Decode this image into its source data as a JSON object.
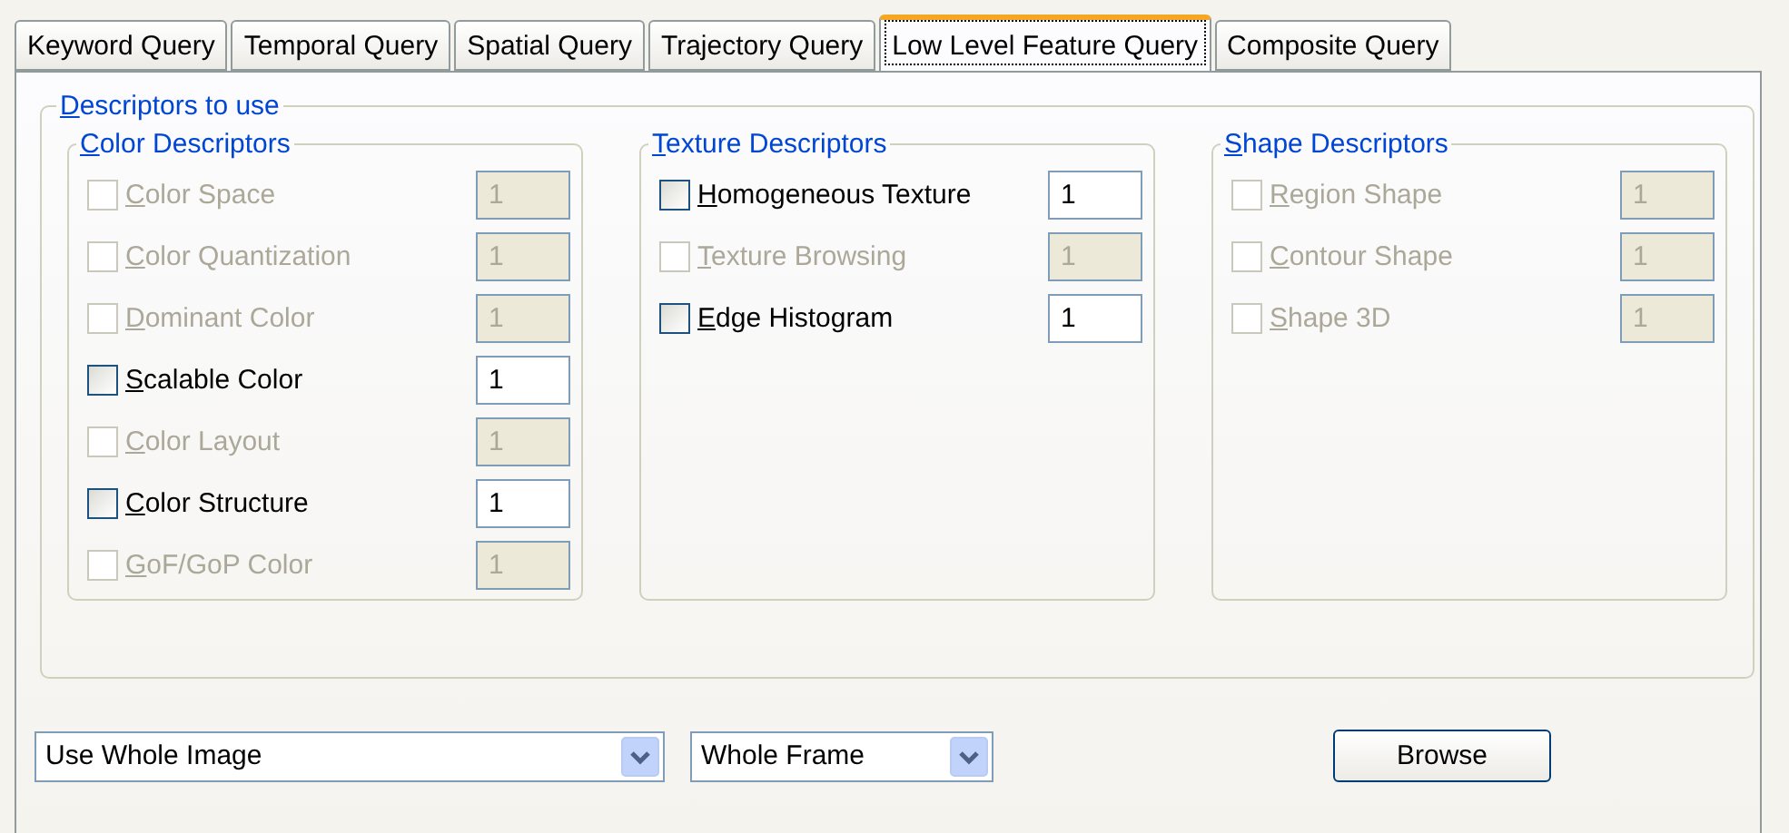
{
  "tabs": [
    {
      "label": "Keyword Query",
      "selected": false
    },
    {
      "label": "Temporal Query",
      "selected": false
    },
    {
      "label": "Spatial Query",
      "selected": false
    },
    {
      "label": "Trajectory Query",
      "selected": false
    },
    {
      "label": "Low Level Feature Query",
      "selected": true
    },
    {
      "label": "Composite Query",
      "selected": false
    }
  ],
  "descriptors": {
    "title": "Descriptors to use",
    "groups": [
      {
        "title": "Color Descriptors",
        "items": [
          {
            "label": "Color Space",
            "checked": false,
            "disabled": true,
            "value": "1"
          },
          {
            "label": "Color Quantization",
            "checked": false,
            "disabled": true,
            "value": "1"
          },
          {
            "label": "Dominant Color",
            "checked": false,
            "disabled": true,
            "value": "1"
          },
          {
            "label": "Scalable Color",
            "checked": false,
            "disabled": false,
            "value": "1"
          },
          {
            "label": "Color Layout",
            "checked": false,
            "disabled": true,
            "value": "1"
          },
          {
            "label": "Color Structure",
            "checked": false,
            "disabled": false,
            "value": "1"
          },
          {
            "label": "GoF/GoP Color",
            "checked": false,
            "disabled": true,
            "value": "1"
          }
        ]
      },
      {
        "title": "Texture Descriptors",
        "items": [
          {
            "label": "Homogeneous Texture",
            "checked": false,
            "disabled": false,
            "value": "1"
          },
          {
            "label": "Texture Browsing",
            "checked": false,
            "disabled": true,
            "value": "1"
          },
          {
            "label": "Edge Histogram",
            "checked": false,
            "disabled": false,
            "value": "1"
          }
        ]
      },
      {
        "title": "Shape Descriptors",
        "items": [
          {
            "label": "Region Shape",
            "checked": false,
            "disabled": true,
            "value": "1"
          },
          {
            "label": "Contour Shape",
            "checked": false,
            "disabled": true,
            "value": "1"
          },
          {
            "label": "Shape 3D",
            "checked": false,
            "disabled": true,
            "value": "1"
          }
        ]
      }
    ]
  },
  "region_select": {
    "value": "Use Whole Image"
  },
  "frame_select": {
    "value": "Whole Frame"
  },
  "browse_button": "Browse"
}
